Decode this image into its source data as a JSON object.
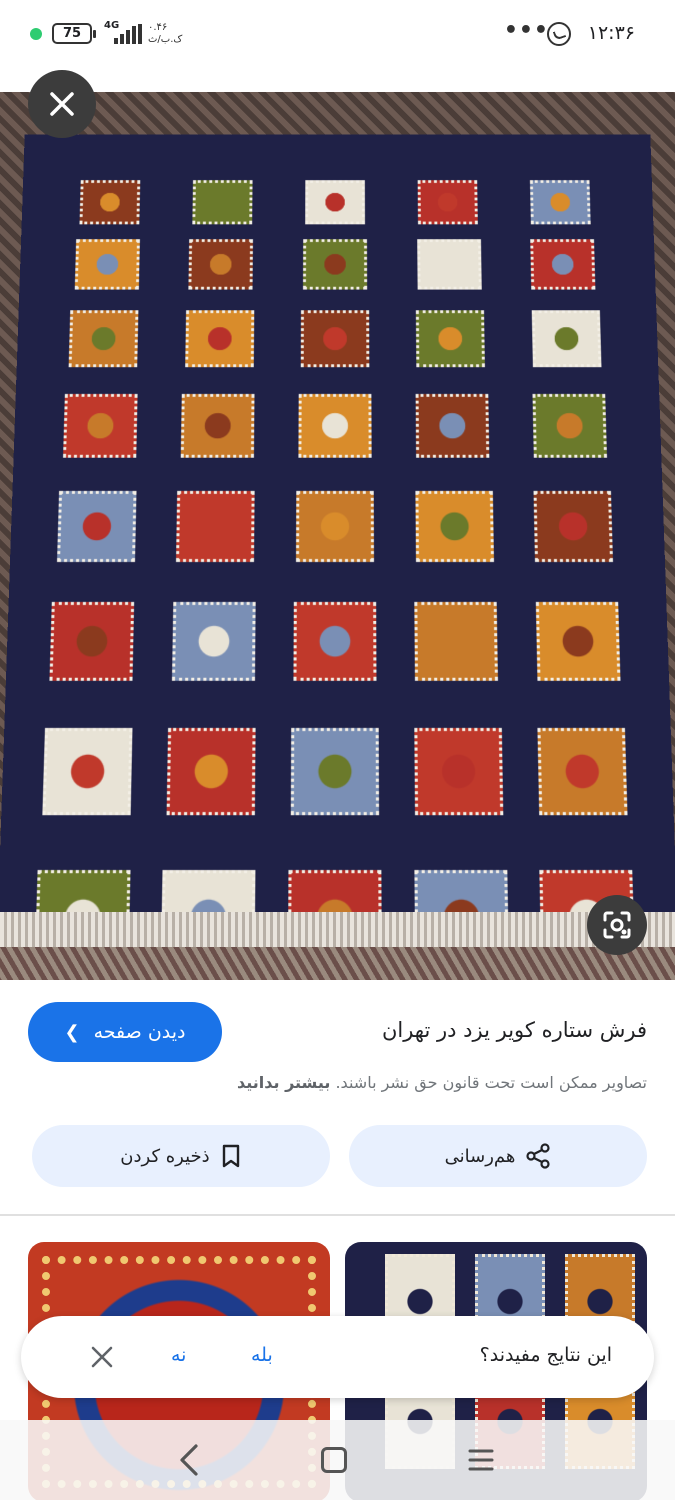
{
  "status_bar": {
    "time": "۱۲:۳۶",
    "battery": "75",
    "network": "4G",
    "speed_value": "۰.۴۶",
    "speed_unit": "ک.ب/ث"
  },
  "result": {
    "title": "فرش ستاره کویر یزد در تهران",
    "visit_label": "دیدن صفحه",
    "copyright_text": "تصاویر ممکن است تحت قانون حق نشر باشند.",
    "learn_more": "بیشتر بدانید",
    "share_label": "هم‌رسانی",
    "save_label": "ذخیره کردن"
  },
  "feedback": {
    "question": "این نتایج مفیدند؟",
    "yes": "بله",
    "no": "نه"
  },
  "colors": {
    "accent": "#1a73e8",
    "chip_bg": "#e8f0fe",
    "rug_navy": "#1f2147"
  },
  "icons": [
    "close-icon",
    "lens-icon",
    "chevron-left-icon",
    "share-icon",
    "bookmark-icon",
    "back-icon",
    "home-icon",
    "recents-icon",
    "whatsapp-icon"
  ]
}
